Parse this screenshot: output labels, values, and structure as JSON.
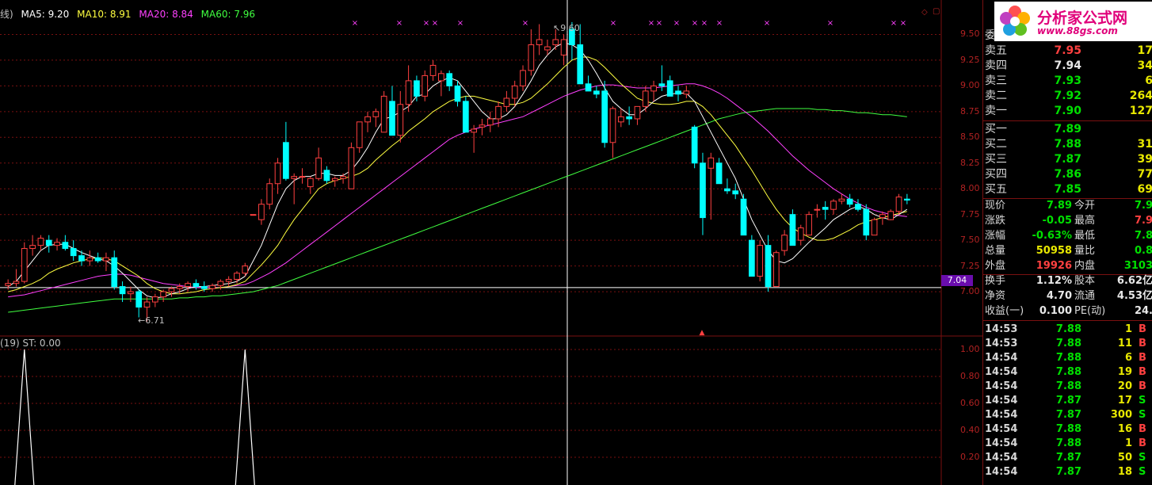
{
  "ma_legend": {
    "prefix": "线)",
    "ma5": "MA5: 9.20",
    "ma10": "MA10: 8.91",
    "ma20": "MA20: 8.84",
    "ma60": "MA60: 7.96",
    "colors": {
      "ma5": "#ffffff",
      "ma10": "#ffff40",
      "ma20": "#ff40ff",
      "ma60": "#40ff40"
    }
  },
  "indicator_legend": "(19)  ST: 0.00",
  "price_axis": [
    "9.50",
    "9.25",
    "9.00",
    "8.75",
    "8.50",
    "8.25",
    "8.00",
    "7.75",
    "7.50",
    "7.25",
    "7.00"
  ],
  "indicator_axis": [
    "1.00",
    "0.80",
    "0.60",
    "0.40",
    "0.20"
  ],
  "current_price_tag": "7.04",
  "high_label": "9.60",
  "low_label": "6.71",
  "colors": {
    "up": "#ff4040",
    "down": "#00ffff",
    "grid": "#7a1010",
    "axis_text": "#b22222"
  },
  "chart_data": {
    "type": "candlestick",
    "ylim": [
      6.6,
      9.65
    ],
    "candles": [
      [
        7.06,
        7.12,
        7.02,
        7.08
      ],
      [
        7.08,
        7.22,
        7.05,
        7.1
      ],
      [
        7.1,
        7.48,
        7.08,
        7.42
      ],
      [
        7.42,
        7.55,
        7.35,
        7.45
      ],
      [
        7.45,
        7.55,
        7.4,
        7.52
      ],
      [
        7.5,
        7.55,
        7.38,
        7.45
      ],
      [
        7.45,
        7.52,
        7.4,
        7.48
      ],
      [
        7.48,
        7.55,
        7.4,
        7.42
      ],
      [
        7.42,
        7.5,
        7.3,
        7.35
      ],
      [
        7.35,
        7.4,
        7.25,
        7.3
      ],
      [
        7.3,
        7.4,
        7.25,
        7.33
      ],
      [
        7.33,
        7.38,
        7.28,
        7.3
      ],
      [
        7.3,
        7.38,
        7.2,
        7.33
      ],
      [
        7.33,
        7.4,
        7.02,
        7.05
      ],
      [
        7.05,
        7.1,
        6.9,
        6.98
      ],
      [
        6.98,
        7.05,
        6.9,
        7.0
      ],
      [
        7.0,
        7.02,
        6.75,
        6.85
      ],
      [
        6.85,
        6.95,
        6.71,
        6.9
      ],
      [
        6.9,
        6.98,
        6.85,
        6.95
      ],
      [
        6.95,
        7.02,
        6.9,
        7.0
      ],
      [
        7.0,
        7.05,
        6.95,
        7.03
      ],
      [
        7.03,
        7.08,
        6.98,
        7.05
      ],
      [
        7.05,
        7.1,
        7.0,
        7.08
      ],
      [
        7.08,
        7.12,
        7.02,
        7.05
      ],
      [
        7.05,
        7.1,
        7.0,
        7.03
      ],
      [
        7.03,
        7.08,
        7.0,
        7.06
      ],
      [
        7.06,
        7.12,
        7.02,
        7.1
      ],
      [
        7.1,
        7.15,
        7.05,
        7.12
      ],
      [
        7.12,
        7.2,
        7.08,
        7.18
      ],
      [
        7.18,
        7.28,
        7.15,
        7.25
      ],
      [
        7.75,
        7.75,
        7.75,
        7.75
      ],
      [
        7.7,
        7.9,
        7.65,
        7.85
      ],
      [
        7.85,
        8.1,
        7.8,
        8.05
      ],
      [
        8.05,
        8.3,
        7.95,
        8.25
      ],
      [
        8.45,
        8.65,
        8.08,
        8.1
      ],
      [
        8.1,
        8.15,
        7.85,
        8.12
      ],
      [
        8.12,
        8.2,
        8.05,
        8.12
      ],
      [
        8.02,
        8.12,
        7.95,
        8.1
      ],
      [
        8.1,
        8.4,
        8.08,
        8.3
      ],
      [
        8.18,
        8.22,
        8.05,
        8.08
      ],
      [
        8.08,
        8.12,
        8.02,
        8.1
      ],
      [
        8.1,
        8.15,
        8.05,
        8.12
      ],
      [
        8.0,
        8.45,
        8.0,
        8.4
      ],
      [
        8.4,
        8.6,
        8.35,
        8.65
      ],
      [
        8.65,
        8.75,
        8.55,
        8.7
      ],
      [
        8.7,
        8.78,
        8.6,
        8.75
      ],
      [
        8.55,
        8.95,
        8.55,
        8.9
      ],
      [
        8.85,
        9.0,
        8.7,
        8.52
      ],
      [
        8.52,
        8.95,
        8.45,
        8.82
      ],
      [
        8.82,
        9.2,
        8.75,
        9.05
      ],
      [
        9.05,
        9.1,
        8.85,
        8.9
      ],
      [
        8.9,
        9.15,
        8.85,
        9.1
      ],
      [
        9.1,
        9.25,
        9.05,
        9.2
      ],
      [
        9.05,
        9.15,
        8.9,
        9.12
      ],
      [
        9.12,
        9.15,
        8.95,
        9.0
      ],
      [
        9.0,
        9.05,
        8.8,
        8.85
      ],
      [
        8.85,
        8.9,
        8.55,
        8.55
      ],
      [
        8.55,
        8.62,
        8.35,
        8.58
      ],
      [
        8.6,
        8.68,
        8.52,
        8.62
      ],
      [
        8.62,
        8.75,
        8.55,
        8.68
      ],
      [
        8.68,
        8.85,
        8.6,
        8.8
      ],
      [
        8.8,
        8.95,
        8.75,
        8.88
      ],
      [
        8.88,
        9.05,
        8.8,
        9.0
      ],
      [
        9.0,
        9.2,
        8.95,
        9.15
      ],
      [
        9.15,
        9.55,
        9.1,
        9.4
      ],
      [
        9.4,
        9.6,
        9.3,
        9.45
      ],
      [
        9.35,
        9.45,
        9.3,
        9.38
      ],
      [
        9.4,
        9.55,
        9.35,
        9.45
      ],
      [
        9.3,
        9.5,
        9.2,
        9.45
      ],
      [
        9.55,
        9.62,
        9.25,
        9.4
      ],
      [
        9.4,
        9.6,
        9.3,
        9.02
      ],
      [
        9.02,
        9.1,
        8.95,
        8.95
      ],
      [
        8.95,
        9.0,
        8.88,
        8.92
      ],
      [
        8.95,
        9.05,
        8.4,
        8.45
      ],
      [
        8.45,
        8.8,
        8.3,
        8.78
      ],
      [
        8.65,
        8.78,
        8.6,
        8.7
      ],
      [
        8.7,
        8.8,
        8.62,
        8.68
      ],
      [
        8.68,
        8.8,
        8.62,
        8.8
      ],
      [
        8.8,
        9.0,
        8.75,
        8.95
      ],
      [
        8.95,
        9.05,
        8.85,
        9.0
      ],
      [
        9.02,
        9.2,
        8.95,
        9.0
      ],
      [
        9.05,
        9.1,
        8.95,
        8.9
      ],
      [
        8.95,
        9.0,
        8.85,
        8.92
      ],
      [
        8.92,
        9.0,
        8.88,
        8.95
      ],
      [
        8.6,
        8.62,
        8.2,
        8.25
      ],
      [
        8.25,
        8.35,
        7.55,
        7.72
      ],
      [
        8.2,
        8.35,
        7.7,
        8.3
      ],
      [
        8.25,
        8.3,
        8.05,
        8.05
      ],
      [
        8.0,
        8.1,
        7.95,
        7.98
      ],
      [
        7.98,
        8.05,
        7.9,
        7.95
      ],
      [
        7.9,
        7.95,
        7.55,
        7.55
      ],
      [
        7.5,
        7.55,
        7.15,
        7.15
      ],
      [
        7.15,
        7.5,
        7.1,
        7.45
      ],
      [
        7.45,
        7.55,
        7.0,
        7.05
      ],
      [
        7.05,
        7.4,
        7.05,
        7.38
      ],
      [
        7.4,
        7.6,
        7.35,
        7.55
      ],
      [
        7.75,
        7.8,
        7.45,
        7.45
      ],
      [
        7.5,
        7.65,
        7.45,
        7.62
      ],
      [
        7.55,
        7.78,
        7.55,
        7.75
      ],
      [
        7.8,
        7.85,
        7.72,
        7.8
      ],
      [
        7.82,
        7.88,
        7.7,
        7.8
      ],
      [
        7.8,
        7.9,
        7.75,
        7.88
      ],
      [
        7.88,
        7.95,
        7.85,
        7.9
      ],
      [
        7.9,
        7.95,
        7.82,
        7.85
      ],
      [
        7.85,
        7.9,
        7.78,
        7.8
      ],
      [
        7.8,
        7.85,
        7.5,
        7.55
      ],
      [
        7.55,
        7.72,
        7.55,
        7.7
      ],
      [
        7.72,
        7.78,
        7.65,
        7.75
      ],
      [
        7.7,
        7.8,
        7.7,
        7.78
      ],
      [
        7.78,
        7.95,
        7.75,
        7.92
      ],
      [
        7.9,
        7.95,
        7.85,
        7.89
      ]
    ],
    "ma5": [
      7.05,
      7.1,
      7.2,
      7.3,
      7.4,
      7.45,
      7.46,
      7.46,
      7.42,
      7.38,
      7.35,
      7.32,
      7.3,
      7.25,
      7.18,
      7.1,
      7.02,
      6.96,
      6.94,
      6.95,
      6.98,
      7.0,
      7.03,
      7.05,
      7.05,
      7.06,
      7.07,
      7.08,
      7.1,
      7.15,
      7.3,
      7.45,
      7.65,
      7.85,
      8.0,
      8.08,
      8.12,
      8.12,
      8.15,
      8.15,
      8.13,
      8.13,
      8.18,
      8.28,
      8.4,
      8.55,
      8.68,
      8.7,
      8.75,
      8.8,
      8.9,
      8.92,
      9.0,
      9.05,
      9.08,
      9.05,
      8.95,
      8.85,
      8.75,
      8.68,
      8.68,
      8.72,
      8.8,
      8.92,
      9.05,
      9.2,
      9.3,
      9.38,
      9.42,
      9.4,
      9.35,
      9.25,
      9.12,
      8.98,
      8.85,
      8.78,
      8.72,
      8.72,
      8.78,
      8.85,
      8.9,
      8.92,
      8.93,
      8.93,
      8.85,
      8.7,
      8.55,
      8.4,
      8.25,
      8.1,
      7.9,
      7.7,
      7.55,
      7.4,
      7.3,
      7.28,
      7.32,
      7.4,
      7.48,
      7.55,
      7.62,
      7.7,
      7.75,
      7.8,
      7.83,
      7.8,
      7.75,
      7.72,
      7.7,
      7.75,
      7.8
    ],
    "ma10": [
      7.0,
      7.02,
      7.05,
      7.08,
      7.12,
      7.18,
      7.22,
      7.25,
      7.28,
      7.3,
      7.32,
      7.33,
      7.32,
      7.3,
      7.25,
      7.2,
      7.15,
      7.08,
      7.03,
      7.0,
      6.98,
      6.98,
      6.99,
      7.0,
      7.02,
      7.03,
      7.04,
      7.05,
      7.07,
      7.1,
      7.18,
      7.26,
      7.35,
      7.45,
      7.58,
      7.7,
      7.8,
      7.9,
      8.0,
      8.05,
      8.08,
      8.1,
      8.12,
      8.15,
      8.2,
      8.28,
      8.35,
      8.42,
      8.48,
      8.56,
      8.62,
      8.68,
      8.75,
      8.8,
      8.85,
      8.88,
      8.9,
      8.9,
      8.88,
      8.86,
      8.84,
      8.82,
      8.82,
      8.84,
      8.88,
      8.95,
      9.02,
      9.1,
      9.18,
      9.25,
      9.28,
      9.28,
      9.25,
      9.18,
      9.1,
      9.02,
      8.95,
      8.88,
      8.85,
      8.83,
      8.82,
      8.82,
      8.83,
      8.85,
      8.85,
      8.8,
      8.72,
      8.62,
      8.52,
      8.42,
      8.3,
      8.18,
      8.05,
      7.92,
      7.8,
      7.7,
      7.62,
      7.57,
      7.53,
      7.5,
      7.5,
      7.52,
      7.56,
      7.6,
      7.65,
      7.68,
      7.7,
      7.72,
      7.74,
      7.76,
      7.78
    ],
    "ma20": [
      6.95,
      6.96,
      6.97,
      6.99,
      7.01,
      7.03,
      7.05,
      7.07,
      7.09,
      7.11,
      7.13,
      7.15,
      7.16,
      7.17,
      7.17,
      7.16,
      7.14,
      7.12,
      7.1,
      7.08,
      7.07,
      7.06,
      7.05,
      7.04,
      7.04,
      7.04,
      7.04,
      7.05,
      7.06,
      7.07,
      7.1,
      7.14,
      7.18,
      7.23,
      7.28,
      7.34,
      7.4,
      7.46,
      7.52,
      7.58,
      7.64,
      7.7,
      7.76,
      7.82,
      7.88,
      7.94,
      8.0,
      8.06,
      8.12,
      8.18,
      8.24,
      8.3,
      8.36,
      8.42,
      8.48,
      8.52,
      8.55,
      8.58,
      8.6,
      8.62,
      8.64,
      8.66,
      8.68,
      8.7,
      8.74,
      8.78,
      8.82,
      8.86,
      8.9,
      8.93,
      8.96,
      8.98,
      9.0,
      9.01,
      9.01,
      9.0,
      8.99,
      8.98,
      8.98,
      8.98,
      8.99,
      9.0,
      9.01,
      9.02,
      9.02,
      9.0,
      8.97,
      8.93,
      8.88,
      8.82,
      8.76,
      8.7,
      8.63,
      8.56,
      8.48,
      8.4,
      8.32,
      8.25,
      8.18,
      8.12,
      8.06,
      8.0,
      7.95,
      7.9,
      7.86,
      7.82,
      7.79,
      7.77,
      7.75,
      7.74,
      7.73
    ],
    "ma60": [
      6.8,
      6.81,
      6.82,
      6.83,
      6.84,
      6.85,
      6.86,
      6.87,
      6.88,
      6.89,
      6.9,
      6.91,
      6.92,
      6.93,
      6.93,
      6.93,
      6.93,
      6.93,
      6.93,
      6.93,
      6.93,
      6.94,
      6.94,
      6.95,
      6.95,
      6.96,
      6.96,
      6.97,
      6.98,
      6.99,
      7.0,
      7.02,
      7.04,
      7.06,
      7.09,
      7.12,
      7.15,
      7.18,
      7.21,
      7.24,
      7.27,
      7.3,
      7.33,
      7.36,
      7.39,
      7.42,
      7.45,
      7.48,
      7.51,
      7.54,
      7.57,
      7.6,
      7.63,
      7.66,
      7.69,
      7.72,
      7.75,
      7.78,
      7.81,
      7.84,
      7.87,
      7.9,
      7.93,
      7.96,
      7.99,
      8.02,
      8.05,
      8.08,
      8.11,
      8.14,
      8.17,
      8.2,
      8.23,
      8.26,
      8.29,
      8.32,
      8.35,
      8.38,
      8.41,
      8.44,
      8.47,
      8.5,
      8.53,
      8.56,
      8.59,
      8.62,
      8.65,
      8.68,
      8.7,
      8.72,
      8.74,
      8.75,
      8.76,
      8.77,
      8.78,
      8.78,
      8.78,
      8.78,
      8.78,
      8.77,
      8.77,
      8.76,
      8.76,
      8.75,
      8.74,
      8.74,
      8.73,
      8.72,
      8.72,
      8.71,
      8.7
    ],
    "indicator_peaks": [
      2,
      29
    ]
  },
  "panel": {
    "header": "委",
    "sell": [
      {
        "label": "卖五",
        "price": "7.95",
        "vol": "17",
        "color": "#ff4040"
      },
      {
        "label": "卖四",
        "price": "7.94",
        "vol": "34",
        "color": "#e8e8e8"
      },
      {
        "label": "卖三",
        "price": "7.93",
        "vol": "6",
        "color": "#00e000"
      },
      {
        "label": "卖二",
        "price": "7.92",
        "vol": "264",
        "color": "#00e000"
      },
      {
        "label": "卖一",
        "price": "7.90",
        "vol": "127",
        "color": "#00e000"
      }
    ],
    "buy": [
      {
        "label": "买一",
        "price": "7.89",
        "vol": "",
        "color": "#00e000"
      },
      {
        "label": "买二",
        "price": "7.88",
        "vol": "31",
        "color": "#00e000"
      },
      {
        "label": "买三",
        "price": "7.87",
        "vol": "39",
        "color": "#00e000"
      },
      {
        "label": "买四",
        "price": "7.86",
        "vol": "77",
        "color": "#00e000"
      },
      {
        "label": "买五",
        "price": "7.85",
        "vol": "69",
        "color": "#00e000"
      }
    ],
    "stats": [
      {
        "l1": "现价",
        "v1": "7.89",
        "c1": "#00e000",
        "l2": "今开",
        "v2": "7.9",
        "c2": "#00e000"
      },
      {
        "l1": "涨跌",
        "v1": "-0.05",
        "c1": "#00e000",
        "l2": "最高",
        "v2": "7.9",
        "c2": "#ff4040"
      },
      {
        "l1": "涨幅",
        "v1": "-0.63%",
        "c1": "#00e000",
        "l2": "最低",
        "v2": "7.8",
        "c2": "#00e000"
      },
      {
        "l1": "总量",
        "v1": "50958",
        "c1": "#e8e800",
        "l2": "量比",
        "v2": "0.8",
        "c2": "#00e000"
      },
      {
        "l1": "外盘",
        "v1": "19926",
        "c1": "#ff4040",
        "l2": "内盘",
        "v2": "3103",
        "c2": "#00e000"
      },
      {
        "l1": "换手",
        "v1": "1.12%",
        "c1": "#e8e8e8",
        "l2": "股本",
        "v2": "6.62亿",
        "c2": "#e8e8e8"
      },
      {
        "l1": "净资",
        "v1": "4.70",
        "c1": "#e8e8e8",
        "l2": "流通",
        "v2": "4.53亿",
        "c2": "#e8e8e8"
      },
      {
        "l1": "收益(一)",
        "v1": "0.100",
        "c1": "#e8e8e8",
        "l2": "PE(动)",
        "v2": "24.",
        "c2": "#e8e8e8"
      }
    ],
    "ticks": [
      {
        "t": "14:53",
        "p": "7.88",
        "v": "1",
        "s": "B",
        "c": "#ff4040"
      },
      {
        "t": "14:53",
        "p": "7.88",
        "v": "11",
        "s": "B",
        "c": "#ff4040"
      },
      {
        "t": "14:54",
        "p": "7.88",
        "v": "6",
        "s": "B",
        "c": "#ff4040"
      },
      {
        "t": "14:54",
        "p": "7.88",
        "v": "19",
        "s": "B",
        "c": "#ff4040"
      },
      {
        "t": "14:54",
        "p": "7.88",
        "v": "20",
        "s": "B",
        "c": "#ff4040"
      },
      {
        "t": "14:54",
        "p": "7.87",
        "v": "17",
        "s": "S",
        "c": "#00e000"
      },
      {
        "t": "14:54",
        "p": "7.87",
        "v": "300",
        "s": "S",
        "c": "#00e000"
      },
      {
        "t": "14:54",
        "p": "7.88",
        "v": "16",
        "s": "B",
        "c": "#ff4040"
      },
      {
        "t": "14:54",
        "p": "7.88",
        "v": "1",
        "s": "B",
        "c": "#ff4040"
      },
      {
        "t": "14:54",
        "p": "7.87",
        "v": "50",
        "s": "S",
        "c": "#00e000"
      },
      {
        "t": "14:54",
        "p": "7.87",
        "v": "18",
        "s": "S",
        "c": "#00e000"
      }
    ]
  },
  "logo": {
    "title": "分析家公式网",
    "url": "www.88gs.com"
  }
}
